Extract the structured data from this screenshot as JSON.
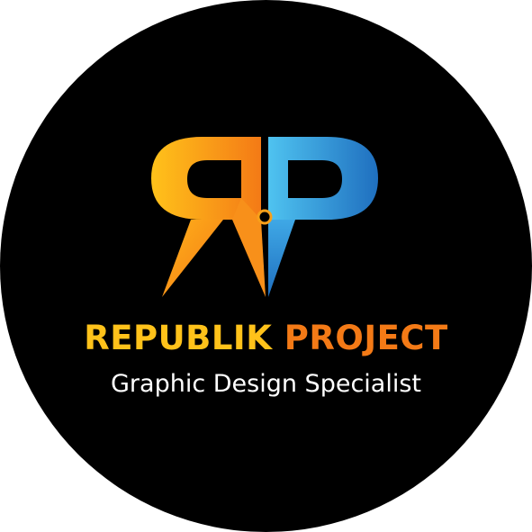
{
  "brand": {
    "word1": "REPUBLIK",
    "word2": "PROJECT"
  },
  "tagline": "Graphic Design Specialist",
  "colors": {
    "background": "#000000",
    "orange_light": "#FFC21A",
    "orange_dark": "#F47A16",
    "blue_light": "#4FC3F0",
    "blue_dark": "#1F6FBF",
    "tagline": "#FFFFFF"
  },
  "logo": {
    "icon": "rp-monogram-icon"
  }
}
